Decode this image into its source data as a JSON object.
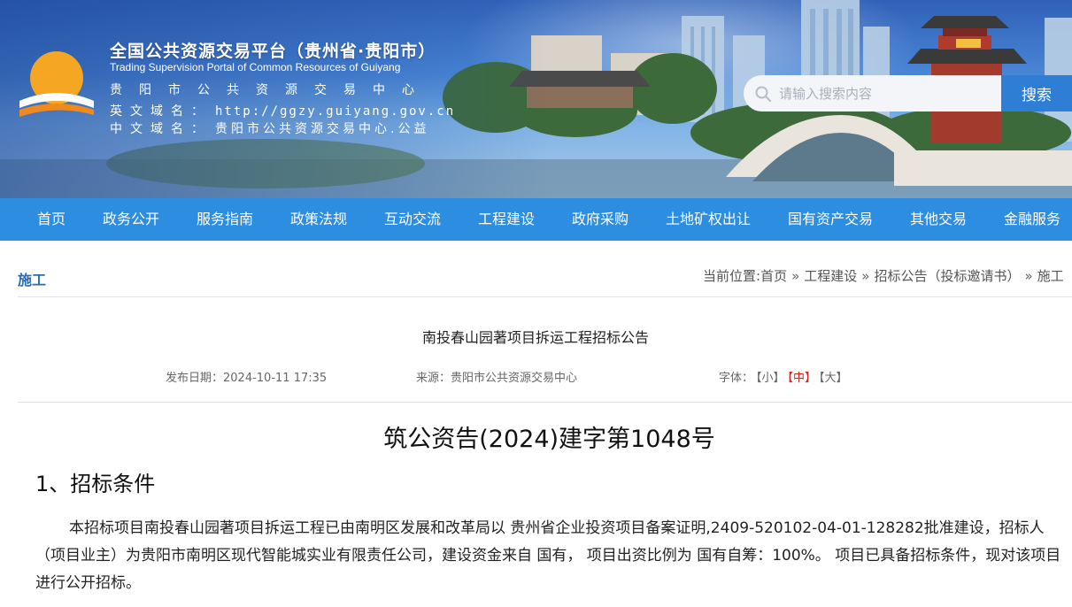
{
  "header": {
    "title": "全国公共资源交易平台（贵州省·贵阳市）",
    "subtitle_en": "Trading Supervision Portal of Common Resources of Guiyang",
    "center_name": "贵阳市公共资源交易中心",
    "en_domain_label": "英文域名：",
    "en_domain_value": "http://ggzy.guiyang.gov.cn",
    "cn_domain_label": "中文域名：",
    "cn_domain_value": "贵阳市公共资源交易中心.公益",
    "pavilion_sign": "甲秀楼"
  },
  "search": {
    "placeholder": "请输入搜索内容",
    "button_label": "搜索"
  },
  "nav": {
    "items": [
      "首页",
      "政务公开",
      "服务指南",
      "政策法规",
      "互动交流",
      "工程建设",
      "政府采购",
      "土地矿权出让",
      "国有资产交易",
      "其他交易",
      "金融服务"
    ]
  },
  "page": {
    "section_label": "施工",
    "breadcrumb_prefix": "当前位置:",
    "breadcrumb": [
      "首页",
      "工程建设",
      "招标公告（投标邀请书）",
      "施工"
    ],
    "breadcrumb_sep": "»"
  },
  "article": {
    "title": "南投春山园著项目拆运工程招标公告",
    "date_label": "发布日期：",
    "date_value": "2024-10-11 17:35",
    "source_label": "来源：",
    "source_value": "贵阳市公共资源交易中心",
    "font_label": "字体：",
    "font_small": "【小】",
    "font_medium": "【中】",
    "font_large": "【大】",
    "doc_number": "筑公资告(2024)建字第1048号",
    "section1_heading": "1、招标条件",
    "section1_body": "本招标项目南投春山园著项目拆运工程已由南明区发展和改革局以 贵州省企业投资项目备案证明,2409-520102-04-01-128282批准建设，招标人（项目业主）为贵阳市南明区现代智能城实业有限责任公司，建设资金来自 国有， 项目出资比例为 国有自筹：100%。 项目已具备招标条件，现对该项目进行公开招标。"
  },
  "colors": {
    "nav_bg": "#2d8de0",
    "search_button": "#2e7ed6",
    "section_label": "#2c6cb5",
    "font_active": "#d9261c"
  },
  "icons": {
    "logo": "sun-logo",
    "search": "search-icon"
  }
}
